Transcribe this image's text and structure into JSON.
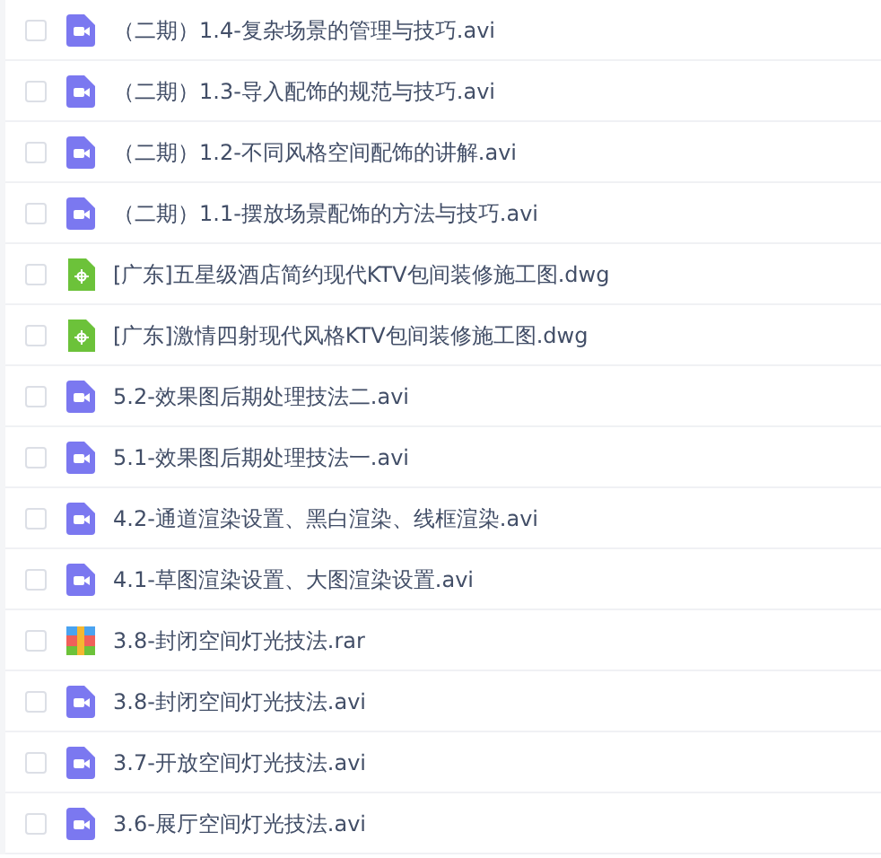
{
  "files": [
    {
      "name": "（二期）1.4-复杂场景的管理与技巧.avi",
      "kind": "video",
      "checked": false
    },
    {
      "name": "（二期）1.3-导入配饰的规范与技巧.avi",
      "kind": "video",
      "checked": false
    },
    {
      "name": "（二期）1.2-不同风格空间配饰的讲解.avi",
      "kind": "video",
      "checked": false
    },
    {
      "name": "（二期）1.1-摆放场景配饰的方法与技巧.avi",
      "kind": "video",
      "checked": false
    },
    {
      "name": "[广东]五星级酒店简约现代KTV包间装修施工图.dwg",
      "kind": "cad",
      "checked": false
    },
    {
      "name": "[广东]激情四射现代风格KTV包间装修施工图.dwg",
      "kind": "cad",
      "checked": false
    },
    {
      "name": "5.2-效果图后期处理技法二.avi",
      "kind": "video",
      "checked": false
    },
    {
      "name": "5.1-效果图后期处理技法一.avi",
      "kind": "video",
      "checked": false
    },
    {
      "name": "4.2-通道渲染设置、黑白渲染、线框渲染.avi",
      "kind": "video",
      "checked": false
    },
    {
      "name": "4.1-草图渲染设置、大图渲染设置.avi",
      "kind": "video",
      "checked": false
    },
    {
      "name": "3.8-封闭空间灯光技法.rar",
      "kind": "archive",
      "checked": false
    },
    {
      "name": "3.8-封闭空间灯光技法.avi",
      "kind": "video",
      "checked": false
    },
    {
      "name": "3.7-开放空间灯光技法.avi",
      "kind": "video",
      "checked": false
    },
    {
      "name": "3.6-展厅空间灯光技法.avi",
      "kind": "video",
      "checked": false
    }
  ]
}
